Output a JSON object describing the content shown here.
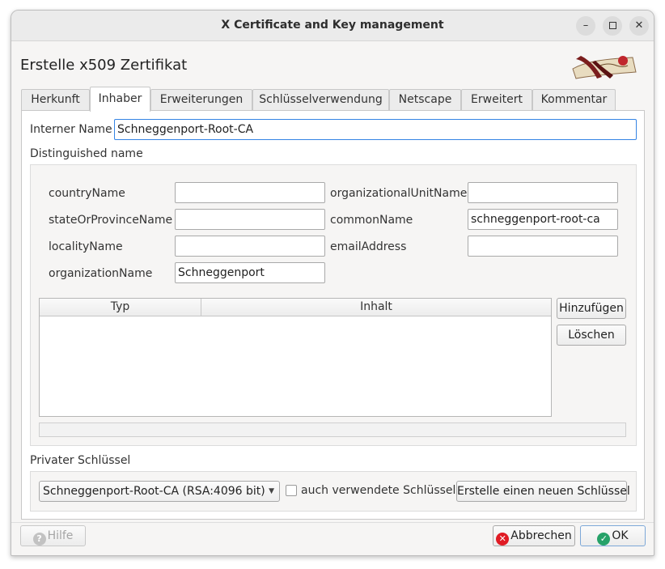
{
  "window": {
    "title": "X Certificate and Key management"
  },
  "dialog": {
    "heading": "Erstelle x509 Zertifikat"
  },
  "tabs": [
    "Herkunft",
    "Inhaber",
    "Erweiterungen",
    "Schlüsselverwendung",
    "Netscape",
    "Erweitert",
    "Kommentar"
  ],
  "active_tab": "Inhaber",
  "internal_name": {
    "label": "Interner Name",
    "value": "Schneggenport-Root-CA"
  },
  "distinguished_name": {
    "title": "Distinguished name",
    "fields": {
      "countryName": {
        "label": "countryName",
        "value": ""
      },
      "stateOrProvinceName": {
        "label": "stateOrProvinceName",
        "value": ""
      },
      "localityName": {
        "label": "localityName",
        "value": ""
      },
      "organizationName": {
        "label": "organizationName",
        "value": "Schneggenport"
      },
      "organizationalUnitName": {
        "label": "organizationalUnitName",
        "value": ""
      },
      "commonName": {
        "label": "commonName",
        "value": "schneggenport-root-ca"
      },
      "emailAddress": {
        "label": "emailAddress",
        "value": ""
      }
    },
    "table": {
      "columns": [
        "Typ",
        "Inhalt"
      ],
      "rows": []
    },
    "add_button": "Hinzufügen",
    "delete_button": "Löschen"
  },
  "private_key": {
    "title": "Privater Schlüssel",
    "selected": "Schneggenport-Root-CA (RSA:4096 bit)",
    "used_keys_label": "auch verwendete Schlüssel",
    "used_keys_checked": false,
    "new_key_button": "Erstelle einen neuen Schlüssel"
  },
  "footer": {
    "help": "Hilfe",
    "cancel": "Abbrechen",
    "ok": "OK"
  },
  "colors": {
    "focus": "#3584e4",
    "cancel_icon": "#e01b24",
    "ok_icon": "#26a269"
  }
}
